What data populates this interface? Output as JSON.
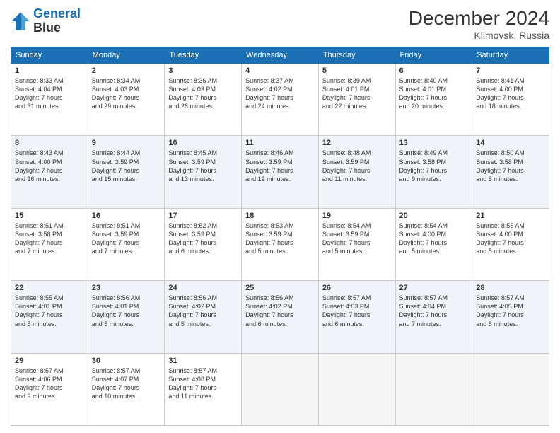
{
  "logo": {
    "line1": "General",
    "line2": "Blue"
  },
  "header": {
    "month": "December 2024",
    "location": "Klimovsk, Russia"
  },
  "weekdays": [
    "Sunday",
    "Monday",
    "Tuesday",
    "Wednesday",
    "Thursday",
    "Friday",
    "Saturday"
  ],
  "rows": [
    [
      {
        "day": "1",
        "text": "Sunrise: 8:33 AM\nSunset: 4:04 PM\nDaylight: 7 hours\nand 31 minutes."
      },
      {
        "day": "2",
        "text": "Sunrise: 8:34 AM\nSunset: 4:03 PM\nDaylight: 7 hours\nand 29 minutes."
      },
      {
        "day": "3",
        "text": "Sunrise: 8:36 AM\nSunset: 4:03 PM\nDaylight: 7 hours\nand 26 minutes."
      },
      {
        "day": "4",
        "text": "Sunrise: 8:37 AM\nSunset: 4:02 PM\nDaylight: 7 hours\nand 24 minutes."
      },
      {
        "day": "5",
        "text": "Sunrise: 8:39 AM\nSunset: 4:01 PM\nDaylight: 7 hours\nand 22 minutes."
      },
      {
        "day": "6",
        "text": "Sunrise: 8:40 AM\nSunset: 4:01 PM\nDaylight: 7 hours\nand 20 minutes."
      },
      {
        "day": "7",
        "text": "Sunrise: 8:41 AM\nSunset: 4:00 PM\nDaylight: 7 hours\nand 18 minutes."
      }
    ],
    [
      {
        "day": "8",
        "text": "Sunrise: 8:43 AM\nSunset: 4:00 PM\nDaylight: 7 hours\nand 16 minutes."
      },
      {
        "day": "9",
        "text": "Sunrise: 8:44 AM\nSunset: 3:59 PM\nDaylight: 7 hours\nand 15 minutes."
      },
      {
        "day": "10",
        "text": "Sunrise: 8:45 AM\nSunset: 3:59 PM\nDaylight: 7 hours\nand 13 minutes."
      },
      {
        "day": "11",
        "text": "Sunrise: 8:46 AM\nSunset: 3:59 PM\nDaylight: 7 hours\nand 12 minutes."
      },
      {
        "day": "12",
        "text": "Sunrise: 8:48 AM\nSunset: 3:59 PM\nDaylight: 7 hours\nand 11 minutes."
      },
      {
        "day": "13",
        "text": "Sunrise: 8:49 AM\nSunset: 3:58 PM\nDaylight: 7 hours\nand 9 minutes."
      },
      {
        "day": "14",
        "text": "Sunrise: 8:50 AM\nSunset: 3:58 PM\nDaylight: 7 hours\nand 8 minutes."
      }
    ],
    [
      {
        "day": "15",
        "text": "Sunrise: 8:51 AM\nSunset: 3:58 PM\nDaylight: 7 hours\nand 7 minutes."
      },
      {
        "day": "16",
        "text": "Sunrise: 8:51 AM\nSunset: 3:59 PM\nDaylight: 7 hours\nand 7 minutes."
      },
      {
        "day": "17",
        "text": "Sunrise: 8:52 AM\nSunset: 3:59 PM\nDaylight: 7 hours\nand 6 minutes."
      },
      {
        "day": "18",
        "text": "Sunrise: 8:53 AM\nSunset: 3:59 PM\nDaylight: 7 hours\nand 5 minutes."
      },
      {
        "day": "19",
        "text": "Sunrise: 8:54 AM\nSunset: 3:59 PM\nDaylight: 7 hours\nand 5 minutes."
      },
      {
        "day": "20",
        "text": "Sunrise: 8:54 AM\nSunset: 4:00 PM\nDaylight: 7 hours\nand 5 minutes."
      },
      {
        "day": "21",
        "text": "Sunrise: 8:55 AM\nSunset: 4:00 PM\nDaylight: 7 hours\nand 5 minutes."
      }
    ],
    [
      {
        "day": "22",
        "text": "Sunrise: 8:55 AM\nSunset: 4:01 PM\nDaylight: 7 hours\nand 5 minutes."
      },
      {
        "day": "23",
        "text": "Sunrise: 8:56 AM\nSunset: 4:01 PM\nDaylight: 7 hours\nand 5 minutes."
      },
      {
        "day": "24",
        "text": "Sunrise: 8:56 AM\nSunset: 4:02 PM\nDaylight: 7 hours\nand 5 minutes."
      },
      {
        "day": "25",
        "text": "Sunrise: 8:56 AM\nSunset: 4:02 PM\nDaylight: 7 hours\nand 6 minutes."
      },
      {
        "day": "26",
        "text": "Sunrise: 8:57 AM\nSunset: 4:03 PM\nDaylight: 7 hours\nand 6 minutes."
      },
      {
        "day": "27",
        "text": "Sunrise: 8:57 AM\nSunset: 4:04 PM\nDaylight: 7 hours\nand 7 minutes."
      },
      {
        "day": "28",
        "text": "Sunrise: 8:57 AM\nSunset: 4:05 PM\nDaylight: 7 hours\nand 8 minutes."
      }
    ],
    [
      {
        "day": "29",
        "text": "Sunrise: 8:57 AM\nSunset: 4:06 PM\nDaylight: 7 hours\nand 9 minutes."
      },
      {
        "day": "30",
        "text": "Sunrise: 8:57 AM\nSunset: 4:07 PM\nDaylight: 7 hours\nand 10 minutes."
      },
      {
        "day": "31",
        "text": "Sunrise: 8:57 AM\nSunset: 4:08 PM\nDaylight: 7 hours\nand 11 minutes."
      },
      {
        "day": "",
        "text": ""
      },
      {
        "day": "",
        "text": ""
      },
      {
        "day": "",
        "text": ""
      },
      {
        "day": "",
        "text": ""
      }
    ]
  ]
}
